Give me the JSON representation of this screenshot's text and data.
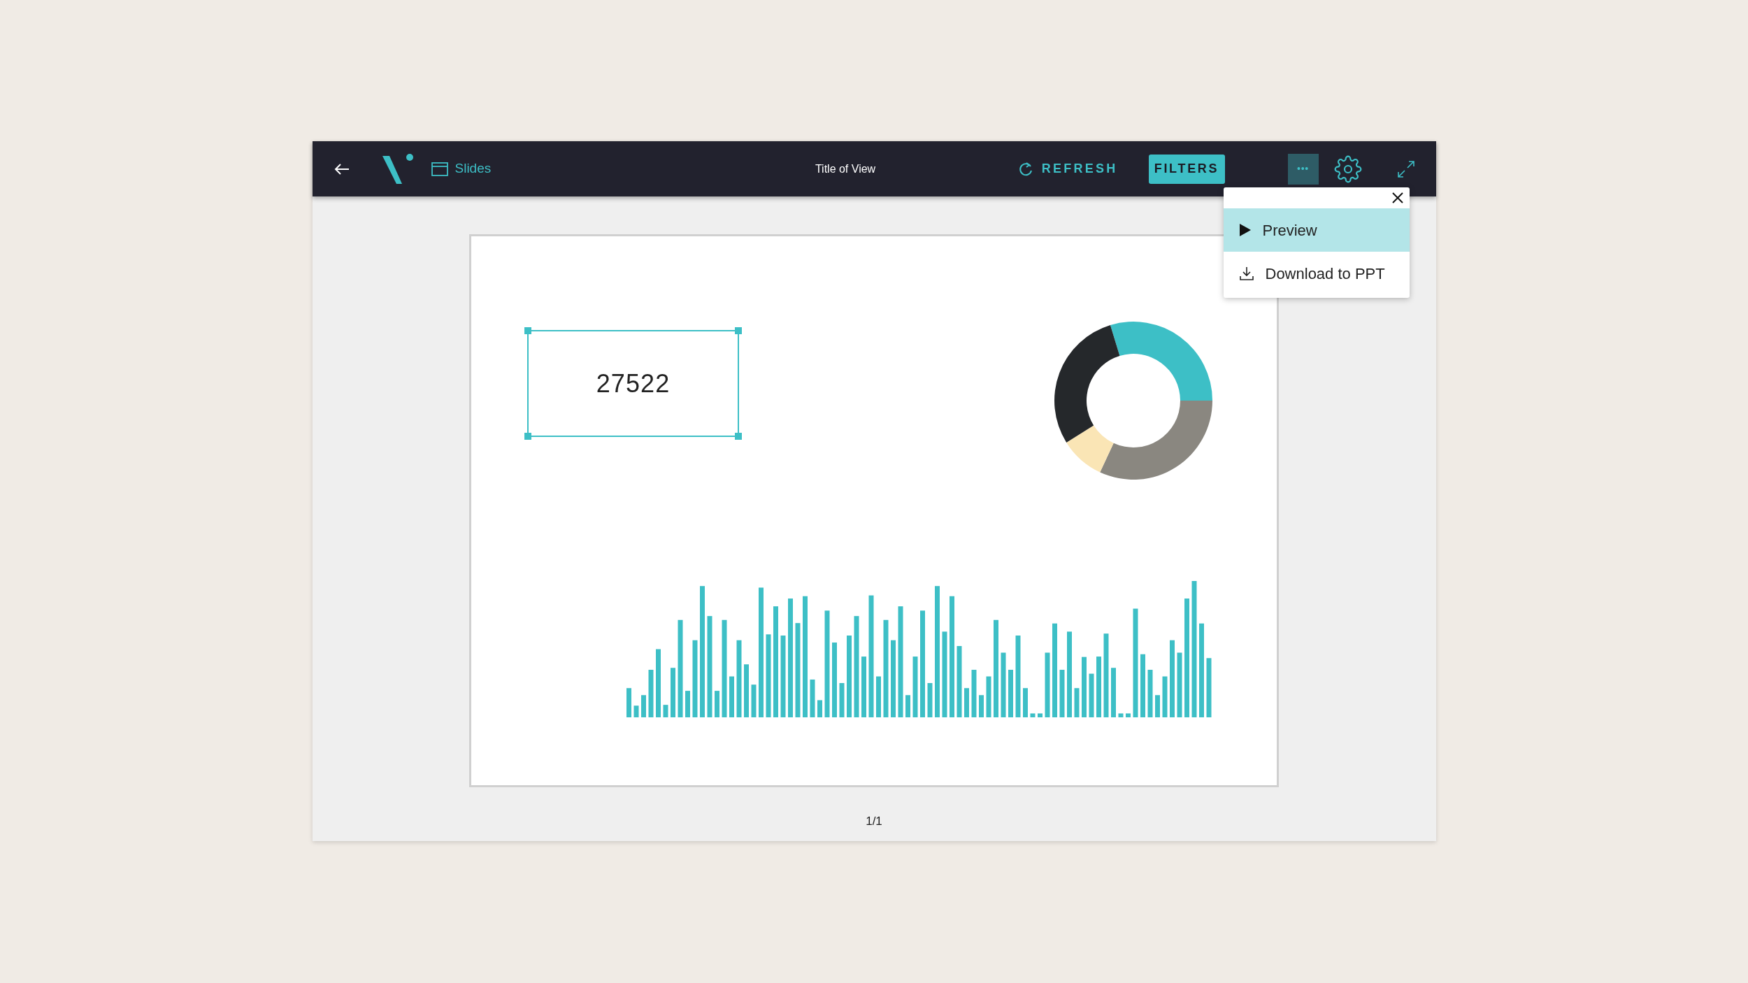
{
  "toolbar": {
    "section_label": "Slides",
    "title": "Title of View",
    "refresh_label": "REFRESH",
    "filters_label": "FILTERS",
    "more_label": "•••"
  },
  "menu": {
    "items": [
      {
        "kind": "preview",
        "label": "Preview",
        "selected": true
      },
      {
        "kind": "download",
        "label": "Download to PPT",
        "selected": false
      }
    ]
  },
  "slide": {
    "kpi_value": "27522",
    "kpi_selected": true
  },
  "page_indicator": "1/1"
}
